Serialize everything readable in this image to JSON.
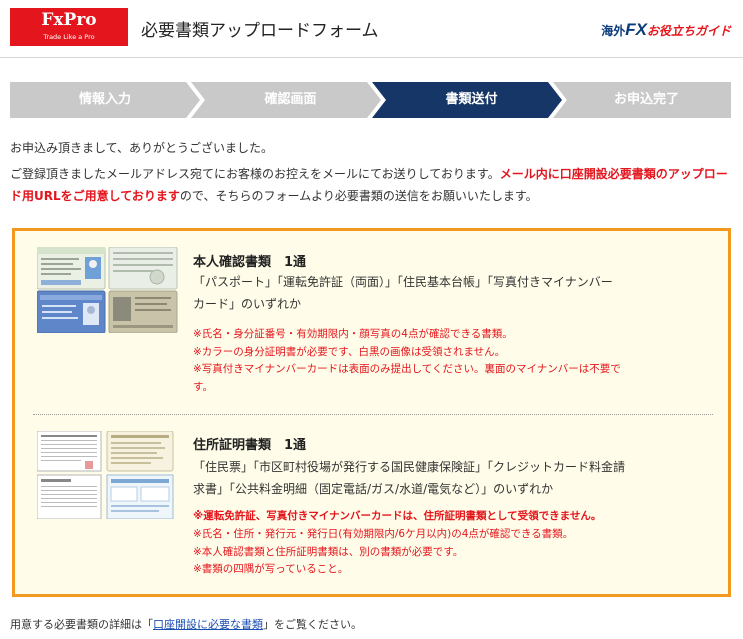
{
  "header": {
    "logo_brand": "FxPro",
    "logo_tagline": "Trade Like a Pro",
    "title": "必要書類アップロードフォーム",
    "partner_prefix": "海外",
    "partner_fx": "FX",
    "partner_suffix": "お役立ちガイド"
  },
  "steps": [
    {
      "label": "情報入力",
      "active": false
    },
    {
      "label": "確認画面",
      "active": false
    },
    {
      "label": "書類送付",
      "active": true
    },
    {
      "label": "お申込完了",
      "active": false
    }
  ],
  "colors": {
    "accent_red": "#e4151d",
    "step_active": "#153666",
    "step_inactive": "#c9c9c9",
    "box_border": "#f39a1e",
    "box_background": "#fffde9",
    "link": "#1a4db0"
  },
  "intro": {
    "line1": "お申込み頂きまして、ありがとうございました。",
    "line2_part1": "ご登録頂きましたメールアドレス宛てにお客様のお控えをメールにてお送りしております。",
    "line2_highlight": "メール内に口座開設必要書類のアップロード用URLをご用意しております",
    "line2_part2": "ので、そちらのフォームより必要書類の送信をお願いいたします。"
  },
  "documents": {
    "identity": {
      "title": "本人確認書類　1通",
      "desc_line1": "「パスポート」「運転免許証（両面）」「住民基本台帳」「写真付きマイナンバー",
      "desc_line2": "カード」のいずれか",
      "notes": [
        "※氏名・身分証番号・有効期限内・顔写真の4点が確認できる書類。",
        "※カラーの身分証明書が必要です、白黒の画像は受領されません。",
        "※写真付きマイナンバーカードは表面のみ提出してください。裏面のマイナンバーは不要で",
        "す。"
      ]
    },
    "address": {
      "title": "住所証明書類　1通",
      "desc_line1": "「住民票」「市区町村役場が発行する国民健康保険証」「クレジットカード料金請",
      "desc_line2": "求書」「公共料金明細（固定電話/ガス/水道/電気など）」のいずれか",
      "notes_bold": "※運転免許証、写真付きマイナンバーカードは、住所証明書類として受領できません。",
      "notes": [
        "※氏名・住所・発行元・発行日(有効期限内/6ケ月以内)の4点が確認できる書類。",
        "※本人確認書類と住所証明書類は、別の書類が必要です。",
        "※書類の四隅が写っていること。"
      ]
    }
  },
  "footer": {
    "prefix": "用意する必要書類の詳細は「",
    "link": "口座開設に必要な書類",
    "suffix": "」をご覧ください。"
  }
}
